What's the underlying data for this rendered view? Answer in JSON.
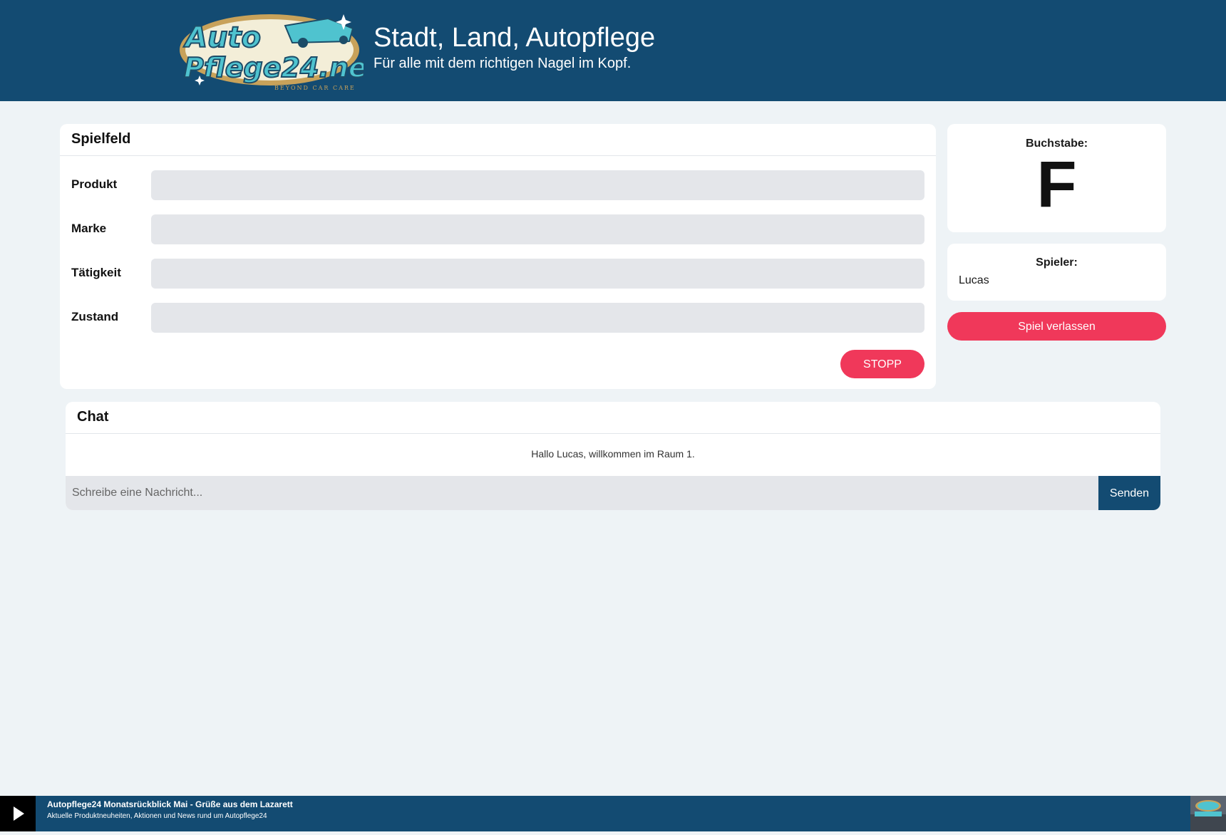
{
  "header": {
    "logo_text": "Auto Pflege24.net",
    "logo_tagline": "BEYOND CAR CARE",
    "title": "Stadt, Land, Autopflege",
    "subtitle": "Für alle mit dem richtigen Nagel im Kopf."
  },
  "spielfeld": {
    "title": "Spielfeld",
    "fields": [
      {
        "label": "Produkt",
        "value": ""
      },
      {
        "label": "Marke",
        "value": ""
      },
      {
        "label": "Tätigkeit",
        "value": ""
      },
      {
        "label": "Zustand",
        "value": ""
      }
    ],
    "stop_label": "STOPP"
  },
  "letter": {
    "label": "Buchstabe:",
    "value": "F"
  },
  "players": {
    "label": "Spieler:",
    "names": [
      "Lucas"
    ]
  },
  "leave_label": "Spiel verlassen",
  "chat": {
    "title": "Chat",
    "messages": [
      "Hallo Lucas, willkommen im Raum 1."
    ],
    "input_placeholder": "Schreibe eine Nachricht...",
    "input_value": "",
    "send_label": "Senden"
  },
  "audio_player": {
    "track_title": "Autopflege24 Monatsrückblick Mai - Grüße aus dem Lazarett",
    "track_description": "Aktuelle Produktneuheiten, Aktionen und News rund um Autopflege24",
    "play_icon": "play-icon"
  },
  "colors": {
    "primary": "#134b72",
    "accent": "#f0385a",
    "background": "#eef3f6"
  }
}
